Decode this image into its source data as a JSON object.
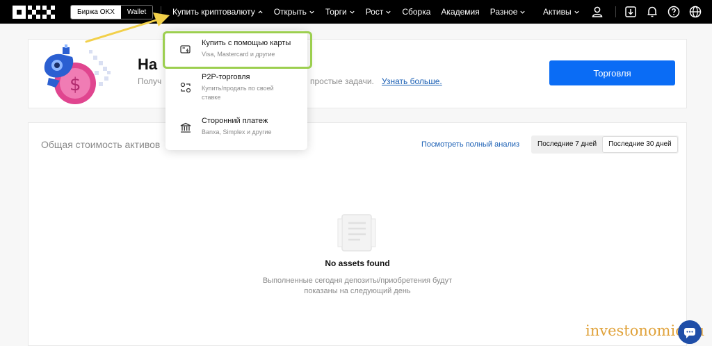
{
  "header": {
    "segment": {
      "exchange": "Биржа OKX",
      "wallet": "Wallet"
    },
    "nav": [
      {
        "label": "Купить криптовалюту",
        "dropdown": true
      },
      {
        "label": "Открыть",
        "dropdown": true
      },
      {
        "label": "Торги",
        "dropdown": true
      },
      {
        "label": "Рост",
        "dropdown": true
      },
      {
        "label": "Сборка",
        "dropdown": false
      },
      {
        "label": "Академия",
        "dropdown": false
      },
      {
        "label": "Разное",
        "dropdown": true
      }
    ],
    "assets_label": "Активы"
  },
  "dropdown": {
    "items": [
      {
        "title": "Купить с помощью карты",
        "desc": "Visa, Mastercard и другие"
      },
      {
        "title": "P2P-торговля",
        "desc_line1": "Купить/продать по своей",
        "desc_line2": "ставке"
      },
      {
        "title": "Сторонний платеж",
        "desc": "Banxa, Simplex и другие"
      }
    ]
  },
  "welcome": {
    "title": "На",
    "subtitle": "Получ",
    "subtitle_end": "простые задачи.",
    "learn_more": "Узнать больше.",
    "trade_button": "Торговля"
  },
  "assets": {
    "title": "Общая стоимость активов",
    "full_analysis": "Посмотреть полный анализ",
    "ranges": [
      "Последние 7 дней",
      "Последние 30 дней"
    ],
    "active_range": 1,
    "empty_title": "No assets found",
    "empty_desc_line1": "Выполненные сегодня депозиты/приобретения будут",
    "empty_desc_line2": "показаны на следующий день"
  },
  "watermark": "investonomic.ru",
  "colors": {
    "accent": "#0a6cf5",
    "link": "#1a5fb4",
    "highlight": "#9ccf4f",
    "arrow": "#f2d04a"
  }
}
